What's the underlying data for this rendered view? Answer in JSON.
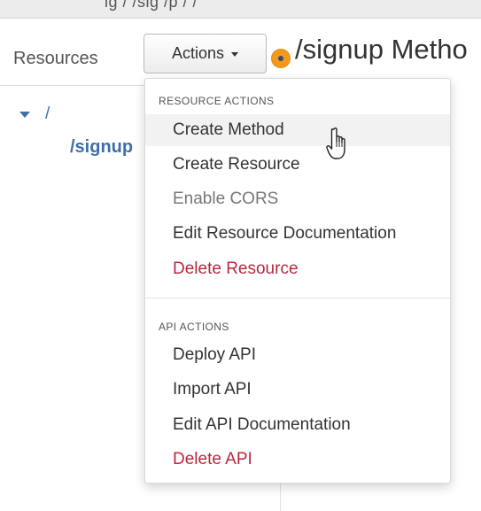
{
  "top_bar": {
    "text": "ig  /  /sig  /p  /  /"
  },
  "sidebar": {
    "label": "Resources",
    "tree": {
      "root": "/",
      "child": "/signup"
    }
  },
  "toolbar": {
    "actions_label": "Actions"
  },
  "main": {
    "title": "/signup Metho"
  },
  "menu": {
    "resource_header": "RESOURCE ACTIONS",
    "resource_items": [
      {
        "label": "Create Method",
        "state": "hovered"
      },
      {
        "label": "Create Resource",
        "state": "normal"
      },
      {
        "label": "Enable CORS",
        "state": "disabled"
      },
      {
        "label": "Edit Resource Documentation",
        "state": "normal"
      },
      {
        "label": "Delete Resource",
        "state": "danger"
      }
    ],
    "api_header": "API ACTIONS",
    "api_items": [
      {
        "label": "Deploy API",
        "state": "normal"
      },
      {
        "label": "Import API",
        "state": "normal"
      },
      {
        "label": "Edit API Documentation",
        "state": "normal"
      },
      {
        "label": "Delete API",
        "state": "danger"
      }
    ]
  },
  "colors": {
    "link": "#3f6fa8",
    "danger": "#b8283c",
    "status_dot": "#f39a1e",
    "hover_bg": "#f2f2f2"
  },
  "icons": {
    "actions_caret": "caret-down",
    "tree_toggle": "caret-down",
    "status": "dot",
    "cursor": "hand-pointer"
  }
}
